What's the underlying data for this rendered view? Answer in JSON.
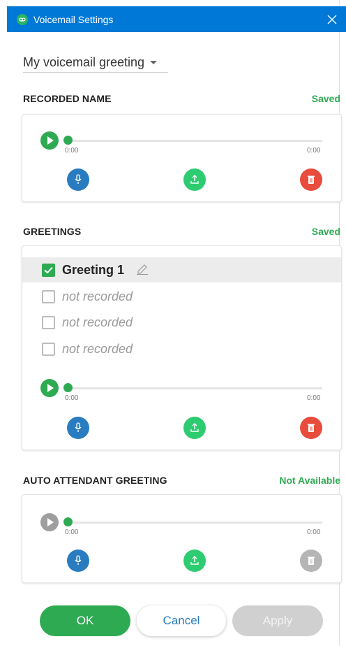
{
  "window": {
    "title": "Voicemail Settings"
  },
  "dropdown": {
    "selected": "My voicemail greeting"
  },
  "recorded_name": {
    "heading": "RECORDED NAME",
    "status": "Saved",
    "player": {
      "time_start": "0:00",
      "time_end": "0:00"
    }
  },
  "greetings": {
    "heading": "GREETINGS",
    "status": "Saved",
    "items": [
      {
        "label": "Greeting 1",
        "checked": true
      },
      {
        "label": "not recorded",
        "checked": false
      },
      {
        "label": "not recorded",
        "checked": false
      },
      {
        "label": "not recorded",
        "checked": false
      }
    ],
    "player": {
      "time_start": "0:00",
      "time_end": "0:00"
    }
  },
  "auto_attendant": {
    "heading": "AUTO ATTENDANT GREETING",
    "status": "Not Available",
    "player": {
      "time_start": "0:00",
      "time_end": "0:00"
    }
  },
  "buttons": {
    "ok": "OK",
    "cancel": "Cancel",
    "apply": "Apply"
  },
  "colors": {
    "titlebar": "#0078d7",
    "green": "#2eaa52",
    "mic_blue": "#2a7cc0",
    "delete_red": "#e74c3c",
    "disabled_gray": "#b5b5b5"
  },
  "icons": {
    "play": "play-icon",
    "mic": "microphone-icon",
    "upload": "upload-icon",
    "delete": "trash-icon",
    "edit": "pencil-icon",
    "close": "close-icon"
  }
}
